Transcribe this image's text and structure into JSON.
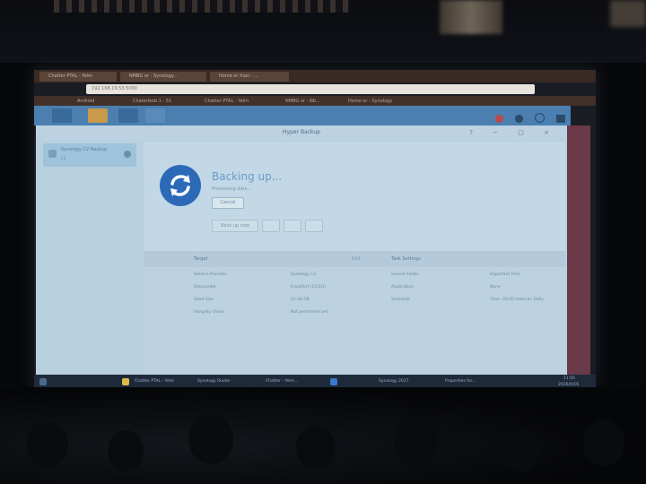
{
  "browser": {
    "tabs": [
      "Chatter PTAL - Yelm",
      "NMBG or - Synology...",
      "Home or Xian - ..."
    ],
    "url": "192.168.19.53:5000",
    "bookmarks": [
      "Android",
      "Chaterlkob 1 - 51",
      "Chatter PTAL - Yelm",
      "NMBG or - Nb...",
      "Home or - Synology"
    ]
  },
  "app": {
    "window_title": "Hyper Backup",
    "window_controls": "? − □ ×",
    "sidebar_item_label": "Synology C2 Backup",
    "sidebar_item_sub": "C2",
    "status_title": "Backing up...",
    "status_sub": "Processing data...",
    "cancel_label": "Cancel",
    "toolbar": {
      "restore_label": "Back up now"
    },
    "info": {
      "target_header": "Target",
      "settings_header": "Task Settings",
      "target_link": "Edit",
      "target_rows": [
        [
          "Service Provider",
          "Synology C2"
        ],
        [
          "Datacenter",
          "Frankfurt (C2 EU)"
        ],
        [
          "Used Size",
          "12.34 GB"
        ],
        [
          "Integrity check",
          "Not performed yet"
        ]
      ],
      "settings_rows": [
        [
          "Source Folder",
          "Important Files"
        ],
        [
          "Application",
          "None"
        ],
        [
          "Schedule",
          "Time: 03:00 Interval: Daily"
        ]
      ]
    }
  },
  "taskbar": {
    "items": [
      "Chatter PTAL - Yelm",
      "Synology Router",
      "Chatter - Yelm...",
      "Synology 2017",
      "Properties for..."
    ],
    "clock": "11:05",
    "date": "2016/9/16"
  },
  "colors": {
    "accent": "#2c6ab8",
    "dsm_bar": "#4a7fb0"
  }
}
